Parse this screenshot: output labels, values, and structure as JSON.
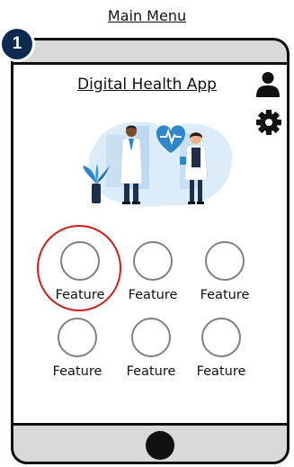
{
  "screen_title": "Main Menu",
  "step_number": "1",
  "app": {
    "title": "Digital Health App",
    "icons": [
      "user-icon",
      "gear-icon"
    ]
  },
  "features": [
    {
      "label": "Feature"
    },
    {
      "label": "Feature"
    },
    {
      "label": "Feature"
    },
    {
      "label": "Feature"
    },
    {
      "label": "Feature"
    },
    {
      "label": "Feature"
    }
  ],
  "colors": {
    "badge": "#0c2a50",
    "highlight": "#d21c1c",
    "illustration_blue": "#2f86c9",
    "phone_frame": "#d9d9d9"
  }
}
